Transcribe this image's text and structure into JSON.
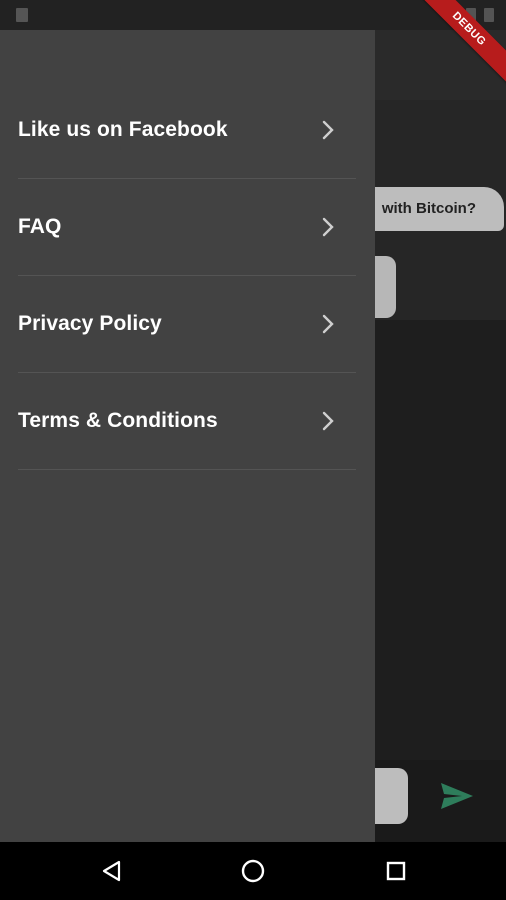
{
  "chat": {
    "user_message": "with Bitcoin?"
  },
  "drawer": {
    "items": [
      {
        "label": "Like us on Facebook",
        "icon": "chevron-right-icon"
      },
      {
        "label": "FAQ",
        "icon": "chevron-right-icon"
      },
      {
        "label": "Privacy Policy",
        "icon": "chevron-right-icon"
      },
      {
        "label": "Terms & Conditions",
        "icon": "chevron-right-icon"
      }
    ]
  },
  "debug_banner": "DEBUG",
  "nav": {
    "back": "back-icon",
    "home": "home-icon",
    "recents": "recents-icon"
  },
  "colors": {
    "drawer_bg": "#424242",
    "send_accent": "#2e7d5b",
    "ribbon": "#b71c1c"
  }
}
